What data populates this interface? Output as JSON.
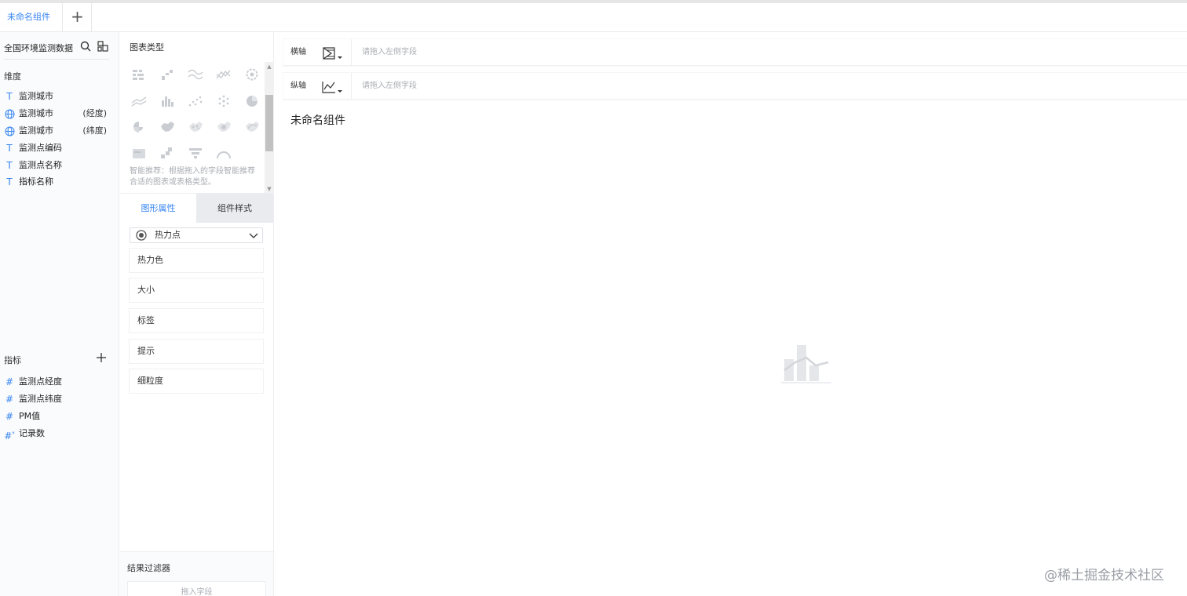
{
  "tabs": {
    "active_label": "未命名组件",
    "add_label": "+"
  },
  "fields_panel": {
    "dataset_name": "全国环境监测数据",
    "dimensions_title": "维度",
    "dimensions": [
      {
        "label": "监测城市",
        "icon": "text-icon",
        "suffix": ""
      },
      {
        "label": "监测城市",
        "icon": "globe-icon",
        "suffix": "(经度)"
      },
      {
        "label": "监测城市",
        "icon": "globe-icon",
        "suffix": "(纬度)"
      },
      {
        "label": "监测点编码",
        "icon": "text-icon",
        "suffix": ""
      },
      {
        "label": "监测点名称",
        "icon": "text-icon",
        "suffix": ""
      },
      {
        "label": "指标名称",
        "icon": "text-icon",
        "suffix": ""
      }
    ],
    "measures_title": "指标",
    "measures": [
      {
        "label": "监测点经度",
        "icon": "number-icon"
      },
      {
        "label": "监测点纬度",
        "icon": "number-icon"
      },
      {
        "label": "PM值",
        "icon": "number-icon"
      },
      {
        "label": "记录数",
        "icon": "calc-number-icon"
      }
    ]
  },
  "config_panel": {
    "chart_type_title": "图表类型",
    "chart_types": [
      "grouped-table-icon",
      "stepped-bar-icon",
      "wave-line-icon",
      "range-line-icon",
      "gear-chart-icon",
      "line-chart-icon",
      "bar-chart-icon",
      "scatter-chart-icon",
      "dot-radial-icon",
      "pie-chart-icon",
      "rose-chart-icon",
      "china-map-icon",
      "point-map-icon",
      "heat-map-icon",
      "flow-map-icon",
      "kpi-card-icon",
      "cross-table-icon",
      "funnel-chart-icon",
      "gauge-chart-icon"
    ],
    "recommend_text": "智能推荐：根据拖入的字段智能推荐合适的图表或表格类型。",
    "tab_properties": "图形属性",
    "tab_style": "组件样式",
    "property_select": "热力点",
    "property_items": [
      "热力色",
      "大小",
      "标签",
      "提示",
      "细粒度"
    ],
    "filter_title": "结果过滤器",
    "filter_placeholder": "拖入字段"
  },
  "main": {
    "x_axis_label": "横轴",
    "y_axis_label": "纵轴",
    "axis_placeholder": "请拖入左侧字段",
    "component_title": "未命名组件",
    "empty_icon": "empty-chart-icon"
  },
  "watermark": "@稀土掘金技术社区",
  "colors": {
    "accent": "#3685f2",
    "panel_bg": "#fafbfc",
    "muted_text": "#a9adb3"
  }
}
